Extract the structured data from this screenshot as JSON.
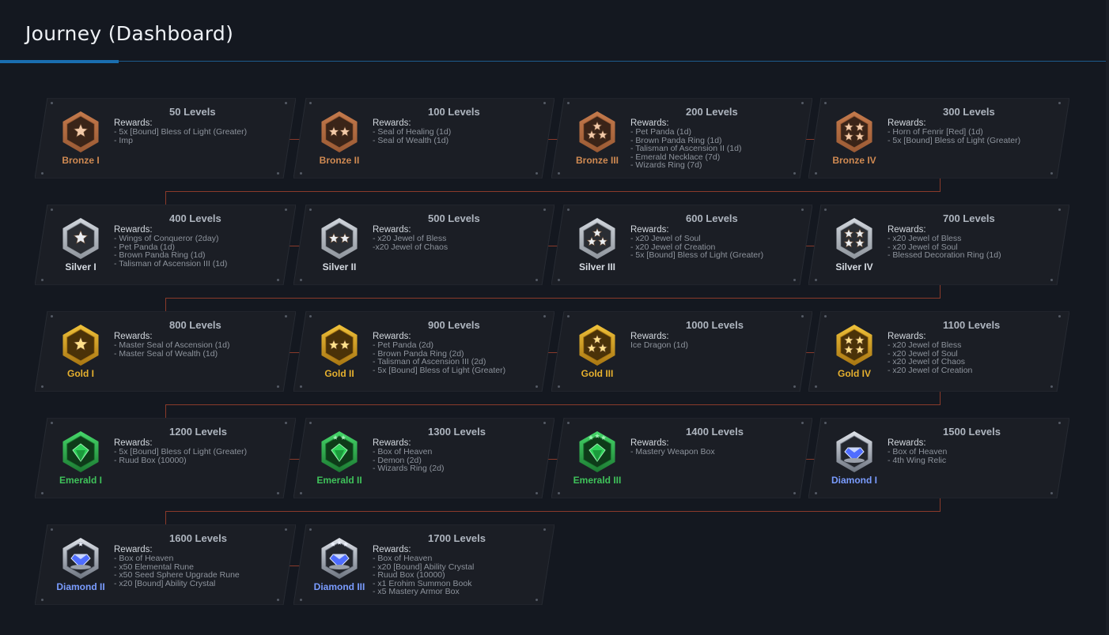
{
  "title": "Journey (Dashboard)",
  "colors": {
    "bronze": "#b4683c",
    "silver": "#c9ced6",
    "gold": "#e0a21f",
    "emerald": "#2fbf4e",
    "diamond": "#7a9cff",
    "connector": "#8a3a2a"
  },
  "tiers": [
    {
      "rank": "Bronze I",
      "tier": "bronze",
      "stars": 1,
      "level": "50 Levels",
      "rewards_label": "Rewards:",
      "rewards": [
        "- 5x [Bound] Bless of Light (Greater)",
        "- Imp"
      ]
    },
    {
      "rank": "Bronze II",
      "tier": "bronze",
      "stars": 2,
      "level": "100 Levels",
      "rewards_label": "Rewards:",
      "rewards": [
        "- Seal of Healing (1d)",
        "- Seal of Wealth (1d)"
      ]
    },
    {
      "rank": "Bronze III",
      "tier": "bronze",
      "stars": 3,
      "level": "200 Levels",
      "rewards_label": "Rewards:",
      "rewards": [
        "- Pet Panda (1d)",
        "- Brown Panda Ring (1d)",
        "- Talisman of Ascension II (1d)",
        "- Emerald Necklace (7d)",
        "- Wizards Ring (7d)"
      ]
    },
    {
      "rank": "Bronze IV",
      "tier": "bronze",
      "stars": 4,
      "level": "300 Levels",
      "rewards_label": "Rewards:",
      "rewards": [
        "- Horn of Fenrir [Red] (1d)",
        "- 5x [Bound] Bless of Light (Greater)"
      ]
    },
    {
      "rank": "Silver I",
      "tier": "silver",
      "stars": 1,
      "level": "400 Levels",
      "rewards_label": "Rewards:",
      "rewards": [
        "- Wings of Conqueror (2day)",
        "- Pet Panda (1d)",
        "- Brown Panda Ring (1d)",
        "- Talisman of Ascension III (1d)"
      ]
    },
    {
      "rank": "Silver II",
      "tier": "silver",
      "stars": 2,
      "level": "500 Levels",
      "rewards_label": "Rewards:",
      "rewards": [
        "- x20 Jewel of Bless",
        "-x20 Jewel of Chaos"
      ]
    },
    {
      "rank": "Silver III",
      "tier": "silver",
      "stars": 3,
      "level": "600 Levels",
      "rewards_label": "Rewards:",
      "rewards": [
        "- x20 Jewel of Soul",
        "- x20 Jewel of Creation",
        "- 5x [Bound] Bless of Light (Greater)"
      ]
    },
    {
      "rank": "Silver IV",
      "tier": "silver",
      "stars": 4,
      "level": "700 Levels",
      "rewards_label": "Rewards:",
      "rewards": [
        "- x20 Jewel of Bless",
        "- x20 Jewel of Soul",
        "- Blessed Decoration Ring (1d)"
      ]
    },
    {
      "rank": "Gold I",
      "tier": "gold",
      "stars": 1,
      "level": "800 Levels",
      "rewards_label": "Rewards:",
      "rewards": [
        "- Master Seal of Ascension (1d)",
        "- Master Seal of Wealth (1d)"
      ]
    },
    {
      "rank": "Gold II",
      "tier": "gold",
      "stars": 2,
      "level": "900 Levels",
      "rewards_label": "Rewards:",
      "rewards": [
        "- Pet Panda (2d)",
        "- Brown Panda Ring (2d)",
        "- Talisman of Ascension III (2d)",
        "- 5x [Bound] Bless of Light (Greater)"
      ]
    },
    {
      "rank": "Gold III",
      "tier": "gold",
      "stars": 3,
      "level": "1000 Levels",
      "rewards_label": "Rewards:",
      "rewards": [
        "Ice Dragon (1d)"
      ]
    },
    {
      "rank": "Gold IV",
      "tier": "gold",
      "stars": 4,
      "level": "1100 Levels",
      "rewards_label": "Rewards:",
      "rewards": [
        "- x20 Jewel of Bless",
        "- x20 Jewel of Soul",
        "- x20 Jewel of Chaos",
        "- x20 Jewel of Creation"
      ]
    },
    {
      "rank": "Emerald I",
      "tier": "emerald",
      "stars": 0,
      "level": "1200 Levels",
      "rewards_label": "Rewards:",
      "rewards": [
        "- 5x [Bound] Bless of Light (Greater)",
        "- Ruud Box (10000)"
      ]
    },
    {
      "rank": "Emerald II",
      "tier": "emerald",
      "stars": 2,
      "level": "1300 Levels",
      "rewards_label": "Rewards:",
      "rewards": [
        "- Box of Heaven",
        "- Demon (2d)",
        "- Wizards Ring (2d)"
      ]
    },
    {
      "rank": "Emerald III",
      "tier": "emerald",
      "stars": 3,
      "level": "1400 Levels",
      "rewards_label": "Rewards:",
      "rewards": [
        "- Mastery Weapon Box"
      ]
    },
    {
      "rank": "Diamond I",
      "tier": "diamond",
      "stars": 0,
      "level": "1500 Levels",
      "rewards_label": "Rewards:",
      "rewards": [
        "- Box of Heaven",
        "- 4th Wing Relic"
      ]
    },
    {
      "rank": "Diamond II",
      "tier": "diamond",
      "stars": 1,
      "level": "1600 Levels",
      "rewards_label": "Rewards:",
      "rewards": [
        "- Box of Heaven",
        "- x50 Elemental Rune",
        "- x50 Seed Sphere Upgrade Rune",
        "- x20 [Bound] Ability Crystal"
      ]
    },
    {
      "rank": "Diamond III",
      "tier": "diamond",
      "stars": 3,
      "level": "1700 Levels",
      "rewards_label": "Rewards:",
      "rewards": [
        "- Box of Heaven",
        "- x20 [Bound] Ability Crystal",
        "- Ruud Box (10000)",
        "- x1 Erohim Summon Book",
        "- x5 Mastery Armor Box"
      ]
    }
  ]
}
